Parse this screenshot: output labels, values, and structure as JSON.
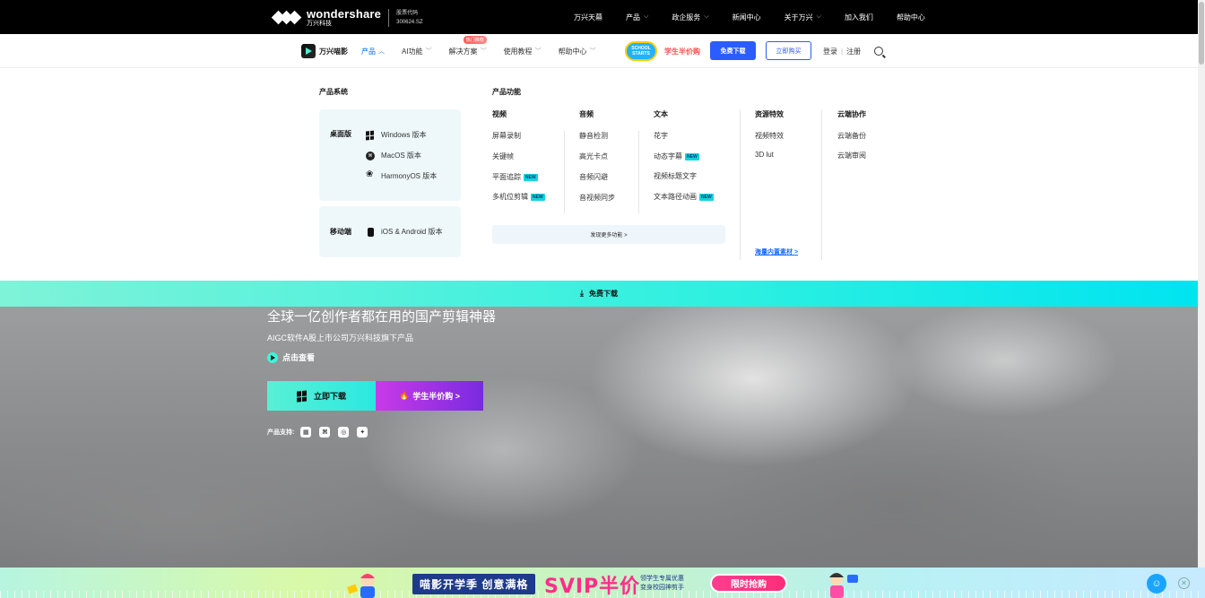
{
  "topbar": {
    "logo_en": "wondershare",
    "logo_cn": "万兴科技",
    "stock_label": "股票代码",
    "stock_code": "300624.SZ",
    "nav": [
      {
        "label": "万兴天幕",
        "dropdown": false
      },
      {
        "label": "产品",
        "dropdown": true
      },
      {
        "label": "政企服务",
        "dropdown": true
      },
      {
        "label": "新闻中心",
        "dropdown": false
      },
      {
        "label": "关于万兴",
        "dropdown": true
      },
      {
        "label": "加入我们",
        "dropdown": false
      },
      {
        "label": "帮助中心",
        "dropdown": false
      }
    ]
  },
  "subnav": {
    "brand": "万兴喵影",
    "items": [
      {
        "label": "产品",
        "active": true
      },
      {
        "label": "AI功能",
        "active": false
      },
      {
        "label": "解决方案",
        "active": false
      },
      {
        "label": "使用教程",
        "active": false
      },
      {
        "label": "帮助中心",
        "active": false
      }
    ],
    "hot_badge": "热门推荐",
    "school_badge": "SCHOOL STARTS",
    "student_promo": "学生半价购",
    "free_download": "免费下载",
    "buy_now": "立即购买",
    "login": "登录",
    "register": "注册"
  },
  "mega": {
    "systems_title": "产品系统",
    "desktop_label": "桌面版",
    "desktop_items": [
      {
        "label": "Windows 版本",
        "icon": "windows-icon"
      },
      {
        "label": "MacOS 版本",
        "icon": "macos-icon"
      },
      {
        "label": "HarmonyOS 版本",
        "icon": "harmonyos-icon"
      }
    ],
    "mobile_label": "移动端",
    "mobile_item": "iOS & Android 版本",
    "features_title": "产品功能",
    "new_tag": "NEW",
    "columns": {
      "video": {
        "title": "视频",
        "items": [
          "屏幕录制",
          "关键帧",
          "平面追踪",
          "多机位剪辑"
        ]
      },
      "audio": {
        "title": "音频",
        "items": [
          "静音检测",
          "高光卡点",
          "音频闪避",
          "音视频同步"
        ]
      },
      "text": {
        "title": "文本",
        "items": [
          "花字",
          "动态字幕",
          "视频标题文字",
          "文本路径动画"
        ]
      },
      "resources": {
        "title": "资源特效",
        "items": [
          "视频特效",
          "3D lut"
        ]
      },
      "cloud": {
        "title": "云端协作",
        "items": [
          "云端备份",
          "云端审阅"
        ]
      }
    },
    "more_features": "发现更多功能 >",
    "asset_link": "海量内置素材 >"
  },
  "download_bar": {
    "label": "免费下载"
  },
  "hero": {
    "title": "全球一亿创作者都在用的国产剪辑神器",
    "subtitle": "AIGC软件A股上市公司万兴科技旗下产品",
    "play_label": "点击查看",
    "download_btn": "立即下载",
    "student_btn": "学生半价购 >",
    "support_label": "产品支持:"
  },
  "promo": {
    "title": "喵影开学季 创意满格",
    "svip": "SVIP半价",
    "desc_line1": "领学生专属优惠",
    "desc_line2": "变身校园神剪手",
    "button": "限时抢购"
  },
  "colors": {
    "accent_blue": "#2a5cff",
    "teal": "#2ef0e0",
    "promo_pink": "#ff2d7a",
    "new_tag": "#14d3e0"
  }
}
